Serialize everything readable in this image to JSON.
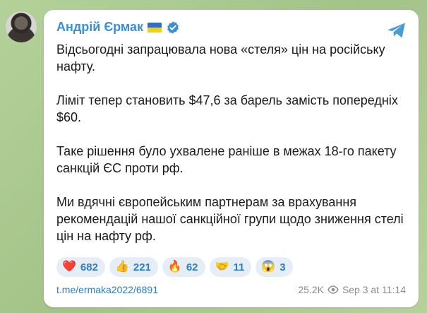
{
  "channel": {
    "name": "Андрій Єрмак"
  },
  "message": {
    "paragraphs": [
      "Відсьогодні запрацювала нова «стеля» цін на російську нафту.",
      "Ліміт тепер становить $47,6 за барель замість попередніх $60.",
      "Таке рішення було ухвалене раніше в межах 18-го пакету санкцій ЄС проти рф.",
      "Ми вдячні європейським партнерам за врахування рекомендацій нашої санкційної групи щодо зниження стелі цін на нафту рф."
    ]
  },
  "reactions": [
    {
      "emoji": "❤️",
      "icon": "heart-icon",
      "count": "682"
    },
    {
      "emoji": "👍",
      "icon": "thumbs-up-icon",
      "count": "221"
    },
    {
      "emoji": "🔥",
      "icon": "fire-icon",
      "count": "62"
    },
    {
      "emoji": "🤝",
      "icon": "handshake-icon",
      "count": "11"
    },
    {
      "emoji": "😱",
      "icon": "scream-icon",
      "count": "3"
    }
  ],
  "footer": {
    "link": "t.me/ermaka2022/6891",
    "views": "25.2K",
    "timestamp": "Sep 3 at 11:14"
  },
  "colors": {
    "accent": "#3d8fd0",
    "reaction_bg": "#e5eef7",
    "background": "#a9c98f"
  }
}
